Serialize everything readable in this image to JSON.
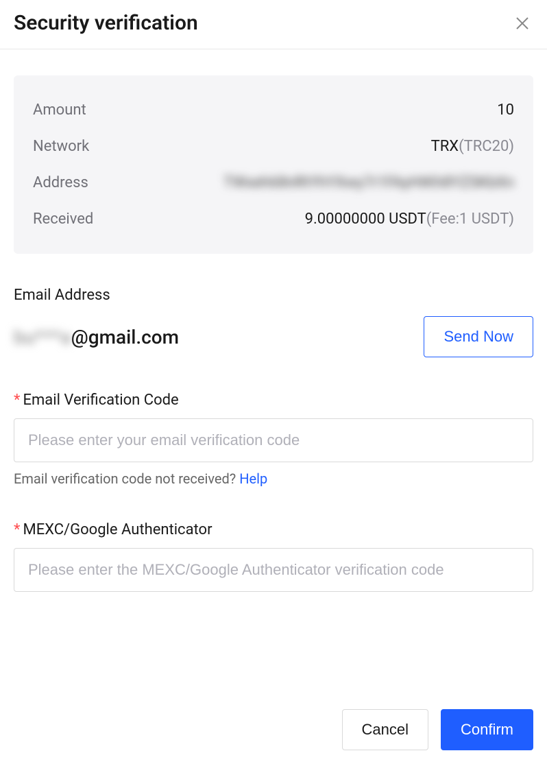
{
  "header": {
    "title": "Security verification"
  },
  "summary": {
    "amount_label": "Amount",
    "amount_value": "10",
    "network_label": "Network",
    "network_value": "TRX",
    "network_suffix": "(TRC20)",
    "address_label": "Address",
    "address_value": "TWxeh68nRtYhYXwy7r1FAyHtKh8YZSKbXn",
    "received_label": "Received",
    "received_value": "9.00000000 USDT",
    "received_suffix": "(Fee:1 USDT)"
  },
  "email": {
    "label": "Email Address",
    "masked_prefix": "bu***a",
    "domain": "@gmail.com",
    "send_button": "Send Now"
  },
  "email_code": {
    "label": "Email Verification Code",
    "placeholder": "Please enter your email verification code",
    "help_text": "Email verification code not received? ",
    "help_link": "Help"
  },
  "auth_code": {
    "label": "MEXC/Google Authenticator",
    "placeholder": "Please enter the MEXC/Google Authenticator verification code"
  },
  "footer": {
    "cancel": "Cancel",
    "confirm": "Confirm"
  }
}
